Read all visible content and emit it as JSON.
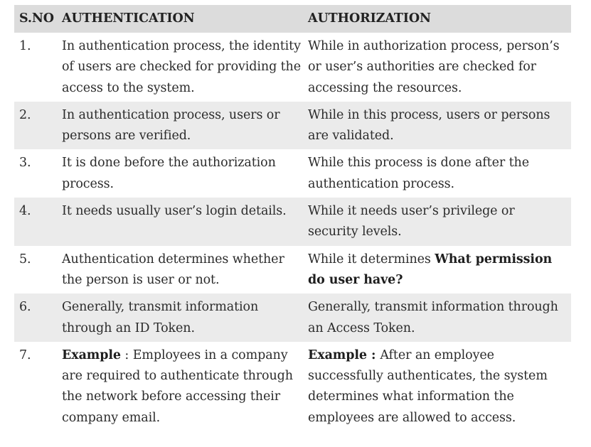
{
  "headers": {
    "sno": "S.NO",
    "authentication": "AUTHENTICATION",
    "authorization": "AUTHORIZATION"
  },
  "rows": [
    {
      "sno": "1.",
      "authentication": "In authentication process, the identity of users are checked for providing the access to the system.",
      "authorization": "While in authorization process, person’s or user’s authorities are checked for accessing the resources."
    },
    {
      "sno": "2.",
      "authentication": "In authentication process, users or persons are verified.",
      "authorization": "While in this process, users or persons are validated."
    },
    {
      "sno": "3.",
      "authentication": "It is done before the authorization process.",
      "authorization": "While this process is done after the authentication process."
    },
    {
      "sno": "4.",
      "authentication": "It needs usually user’s login details.",
      "authorization": "While it needs user’s privilege or security levels."
    },
    {
      "sno": "5.",
      "authentication": "Authentication determines whether the person is user or not.",
      "authorization_prefix": "While it determines ",
      "authorization_bold": "What permission do user have?"
    },
    {
      "sno": "6.",
      "authentication": "Generally, transmit information through an ID Token.",
      "authorization": "Generally, transmit information through an Access Token."
    },
    {
      "sno": "7.",
      "authentication_label": "Example",
      "authentication_sep": " : ",
      "authentication_text": "Employees in a company are required to authenticate through the network before accessing their company email.",
      "authorization_label": "Example",
      "authorization_sep": " : ",
      "authorization_text": "After an employee successfully authenticates, the system determines what information the employees are allowed to access."
    }
  ]
}
